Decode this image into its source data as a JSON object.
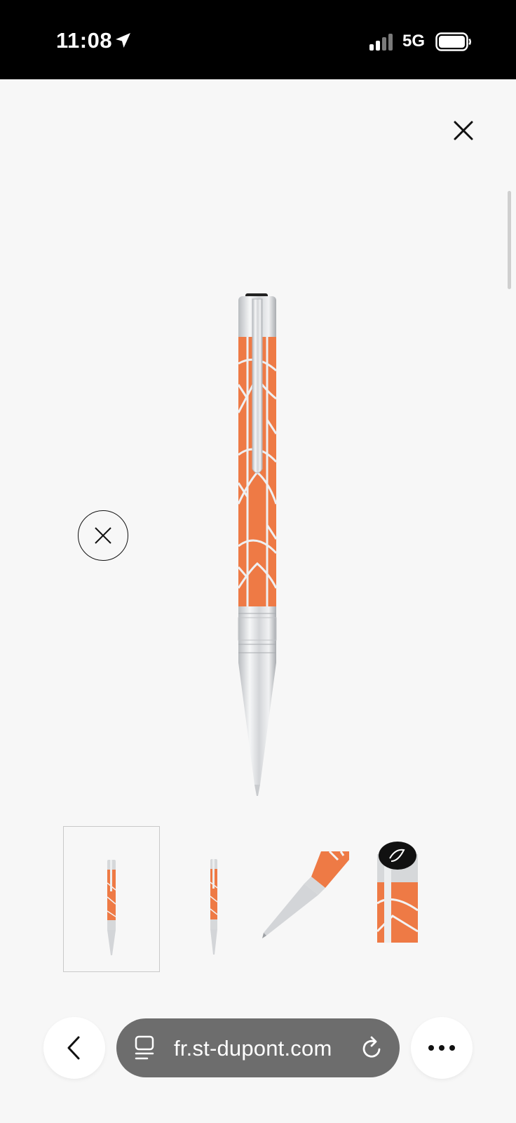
{
  "status_bar": {
    "time": "11:08",
    "network": "5G",
    "icons": [
      "location-arrow-icon",
      "cellular-signal-icon",
      "battery-icon"
    ]
  },
  "viewer": {
    "close_icon": "close-icon",
    "dismiss_icon": "circle-close-icon",
    "main_image": "orange-lacquer-ballpoint-pen",
    "thumbnails": [
      {
        "name": "pen-front-view",
        "selected": true
      },
      {
        "name": "pen-side-view",
        "selected": false
      },
      {
        "name": "pen-tip-close-up",
        "selected": false
      },
      {
        "name": "pen-cap-logo-close-up",
        "selected": false
      }
    ]
  },
  "browser": {
    "url": "fr.st-dupont.com",
    "back_icon": "chevron-left-icon",
    "page_icon": "page-menu-icon",
    "reload_icon": "reload-icon",
    "more_icon": "more-icon"
  },
  "colors": {
    "accent_orange": "#ee7a45",
    "chrome": "#d9dadc",
    "url_pill": "#6d6d6d"
  }
}
